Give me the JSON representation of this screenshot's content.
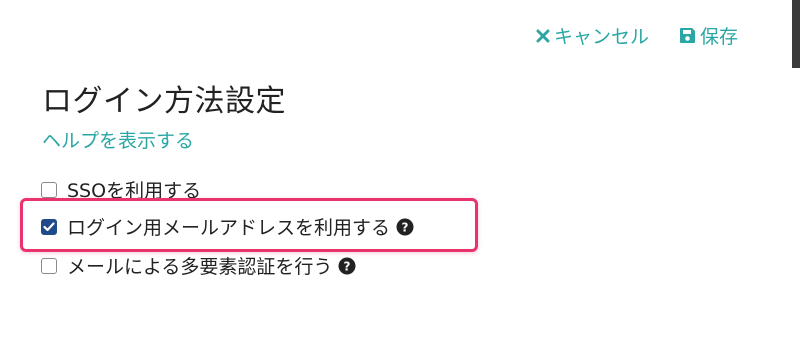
{
  "toolbar": {
    "cancel_label": "キャンセル",
    "save_label": "保存",
    "accent_color": "#2aa7a5"
  },
  "title": "ログイン方法設定",
  "help_link": "ヘルプを表示する",
  "options": [
    {
      "label": "SSOを利用する",
      "checked": false,
      "has_help_icon": false
    },
    {
      "label": "ログイン用メールアドレスを利用する",
      "checked": true,
      "has_help_icon": true
    },
    {
      "label": "メールによる多要素認証を行う",
      "checked": false,
      "has_help_icon": true
    }
  ],
  "highlight_color": "#e8336d",
  "checkbox_checked_color": "#1f4a8c"
}
